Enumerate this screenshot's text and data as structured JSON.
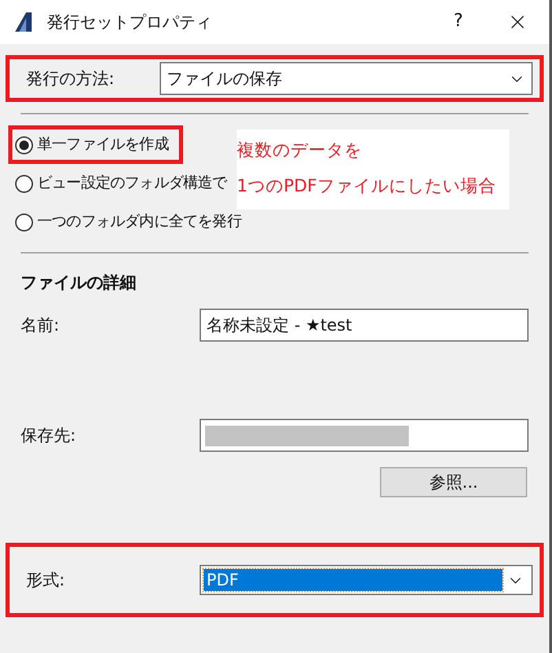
{
  "window": {
    "title": "発行セットプロパティ",
    "help": "?"
  },
  "method": {
    "label": "発行の方法:",
    "value": "ファイルの保存",
    "highlighted": true
  },
  "options": [
    {
      "label": "単一ファイルを作成",
      "selected": true,
      "highlighted": true
    },
    {
      "label": "ビュー設定のフォルダ構造で",
      "selected": false,
      "highlighted": false
    },
    {
      "label": "一つのフォルダ内に全てを発行",
      "selected": false,
      "highlighted": false
    }
  ],
  "annotation": [
    "複数のデータを",
    "1つのPDFファイルにしたい場合"
  ],
  "details": {
    "heading": "ファイルの詳細",
    "name_label": "名前:",
    "name_value": "名称未設定 - ★test",
    "path_label": "保存先:",
    "browse": "参照..."
  },
  "format": {
    "label": "形式:",
    "value": "PDF",
    "highlighted": true
  }
}
